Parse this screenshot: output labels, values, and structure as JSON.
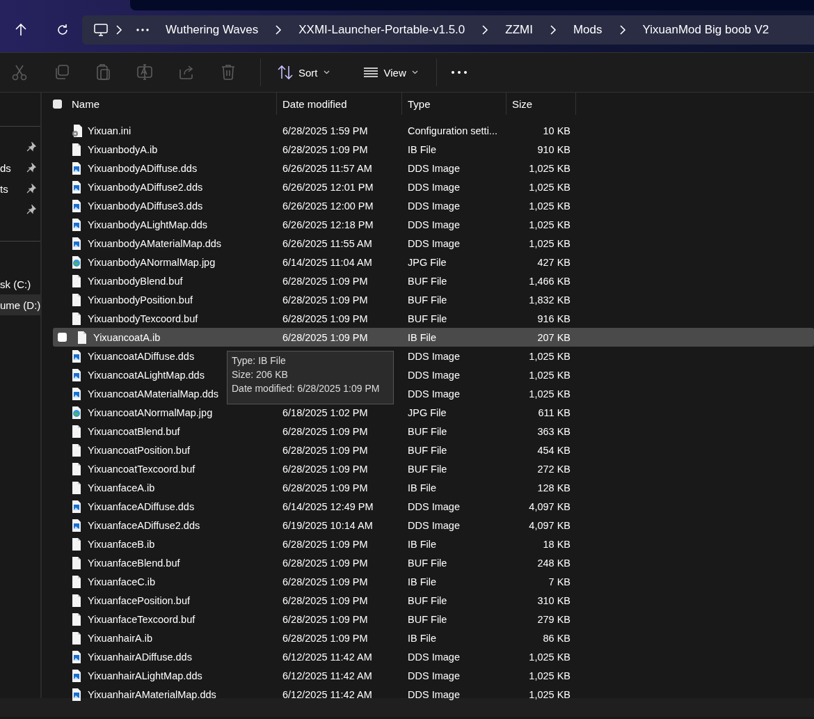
{
  "breadcrumbs": [
    "Wuthering Waves",
    "XXMI-Launcher-Portable-v1.5.0",
    "ZZMI",
    "Mods",
    "YixuanMod Big boob V2"
  ],
  "toolbar": {
    "actions": [
      {
        "kind": "cut",
        "disabled": true
      },
      {
        "kind": "copy",
        "disabled": true
      },
      {
        "kind": "paste",
        "disabled": true
      },
      {
        "kind": "rename",
        "disabled": true
      },
      {
        "kind": "share",
        "disabled": true
      },
      {
        "kind": "delete",
        "disabled": true
      }
    ],
    "sort": "Sort",
    "view": "View"
  },
  "sidebar": {
    "sections": [
      {
        "items": [
          {
            "pinned": true
          },
          {
            "label": "ds",
            "pinned": true
          },
          {
            "label": "ts",
            "pinned": true
          },
          {
            "pinned": true
          }
        ]
      },
      {
        "items": [
          {
            "label": "sk (C:)",
            "selected": false
          },
          {
            "label": "ume (D:)",
            "selected": true
          }
        ]
      }
    ]
  },
  "table": {
    "select_all": {
      "checked": false
    },
    "columns": [
      "Name",
      "Date modified",
      "Type",
      "Size"
    ],
    "rows": [
      {
        "name": "Yixuan.ini",
        "date": "6/28/2025 1:59 PM",
        "type": "Configuration setti...",
        "size": "10 KB",
        "kind": "config",
        "selected": false
      },
      {
        "name": "YixuanbodyA.ib",
        "date": "6/28/2025 1:09 PM",
        "type": "IB File",
        "size": "910 KB",
        "kind": "file",
        "selected": false
      },
      {
        "name": "YixuanbodyADiffuse.dds",
        "date": "6/26/2025 11:57 AM",
        "type": "DDS Image",
        "size": "1,025 KB",
        "kind": "image",
        "selected": false
      },
      {
        "name": "YixuanbodyADiffuse2.dds",
        "date": "6/26/2025 12:01 PM",
        "type": "DDS Image",
        "size": "1,025 KB",
        "kind": "image",
        "selected": false
      },
      {
        "name": "YixuanbodyADiffuse3.dds",
        "date": "6/26/2025 12:00 PM",
        "type": "DDS Image",
        "size": "1,025 KB",
        "kind": "image",
        "selected": false
      },
      {
        "name": "YixuanbodyALightMap.dds",
        "date": "6/26/2025 12:18 PM",
        "type": "DDS Image",
        "size": "1,025 KB",
        "kind": "image",
        "selected": false
      },
      {
        "name": "YixuanbodyAMaterialMap.dds",
        "date": "6/26/2025 11:55 AM",
        "type": "DDS Image",
        "size": "1,025 KB",
        "kind": "image",
        "selected": false
      },
      {
        "name": "YixuanbodyANormalMap.jpg",
        "date": "6/14/2025 11:04 AM",
        "type": "JPG File",
        "size": "427 KB",
        "kind": "photo",
        "selected": false
      },
      {
        "name": "YixuanbodyBlend.buf",
        "date": "6/28/2025 1:09 PM",
        "type": "BUF File",
        "size": "1,466 KB",
        "kind": "file",
        "selected": false
      },
      {
        "name": "YixuanbodyPosition.buf",
        "date": "6/28/2025 1:09 PM",
        "type": "BUF File",
        "size": "1,832 KB",
        "kind": "file",
        "selected": false
      },
      {
        "name": "YixuanbodyTexcoord.buf",
        "date": "6/28/2025 1:09 PM",
        "type": "BUF File",
        "size": "916 KB",
        "kind": "file",
        "selected": false
      },
      {
        "name": "YixuancoatA.ib",
        "date": "6/28/2025 1:09 PM",
        "type": "IB File",
        "size": "207 KB",
        "kind": "file",
        "selected": true
      },
      {
        "name": "YixuancoatADiffuse.dds",
        "type": "DDS Image",
        "size": "1,025 KB",
        "kind": "image",
        "selected": false
      },
      {
        "name": "YixuancoatALightMap.dds",
        "type": "DDS Image",
        "size": "1,025 KB",
        "kind": "image",
        "selected": false
      },
      {
        "name": "YixuancoatAMaterialMap.dds",
        "type": "DDS Image",
        "size": "1,025 KB",
        "kind": "image",
        "selected": false
      },
      {
        "name": "YixuancoatANormalMap.jpg",
        "date": "6/18/2025 1:02 PM",
        "type": "JPG File",
        "size": "611 KB",
        "kind": "photo",
        "selected": false
      },
      {
        "name": "YixuancoatBlend.buf",
        "date": "6/28/2025 1:09 PM",
        "type": "BUF File",
        "size": "363 KB",
        "kind": "file",
        "selected": false
      },
      {
        "name": "YixuancoatPosition.buf",
        "date": "6/28/2025 1:09 PM",
        "type": "BUF File",
        "size": "454 KB",
        "kind": "file",
        "selected": false
      },
      {
        "name": "YixuancoatTexcoord.buf",
        "date": "6/28/2025 1:09 PM",
        "type": "BUF File",
        "size": "272 KB",
        "kind": "file",
        "selected": false
      },
      {
        "name": "YixuanfaceA.ib",
        "date": "6/28/2025 1:09 PM",
        "type": "IB File",
        "size": "128 KB",
        "kind": "file",
        "selected": false
      },
      {
        "name": "YixuanfaceADiffuse.dds",
        "date": "6/14/2025 12:49 PM",
        "type": "DDS Image",
        "size": "4,097 KB",
        "kind": "image",
        "selected": false
      },
      {
        "name": "YixuanfaceADiffuse2.dds",
        "date": "6/19/2025 10:14 AM",
        "type": "DDS Image",
        "size": "4,097 KB",
        "kind": "image",
        "selected": false
      },
      {
        "name": "YixuanfaceB.ib",
        "date": "6/28/2025 1:09 PM",
        "type": "IB File",
        "size": "18 KB",
        "kind": "file",
        "selected": false
      },
      {
        "name": "YixuanfaceBlend.buf",
        "date": "6/28/2025 1:09 PM",
        "type": "BUF File",
        "size": "248 KB",
        "kind": "file",
        "selected": false
      },
      {
        "name": "YixuanfaceC.ib",
        "date": "6/28/2025 1:09 PM",
        "type": "IB File",
        "size": "7 KB",
        "kind": "file",
        "selected": false
      },
      {
        "name": "YixuanfacePosition.buf",
        "date": "6/28/2025 1:09 PM",
        "type": "BUF File",
        "size": "310 KB",
        "kind": "file",
        "selected": false
      },
      {
        "name": "YixuanfaceTexcoord.buf",
        "date": "6/28/2025 1:09 PM",
        "type": "BUF File",
        "size": "279 KB",
        "kind": "file",
        "selected": false
      },
      {
        "name": "YixuanhairA.ib",
        "date": "6/28/2025 1:09 PM",
        "type": "IB File",
        "size": "86 KB",
        "kind": "file",
        "selected": false
      },
      {
        "name": "YixuanhairADiffuse.dds",
        "date": "6/12/2025 11:42 AM",
        "type": "DDS Image",
        "size": "1,025 KB",
        "kind": "image",
        "selected": false
      },
      {
        "name": "YixuanhairALightMap.dds",
        "date": "6/12/2025 11:42 AM",
        "type": "DDS Image",
        "size": "1,025 KB",
        "kind": "image",
        "selected": false
      },
      {
        "name": "YixuanhairAMaterialMap.dds",
        "date": "6/12/2025 11:42 AM",
        "type": "DDS Image",
        "size": "1,025 KB",
        "kind": "image",
        "selected": false
      }
    ]
  },
  "tooltip": {
    "lines": [
      "Type: IB File",
      "Size: 206 KB",
      "Date modified: 6/28/2025 1:09 PM"
    ]
  }
}
